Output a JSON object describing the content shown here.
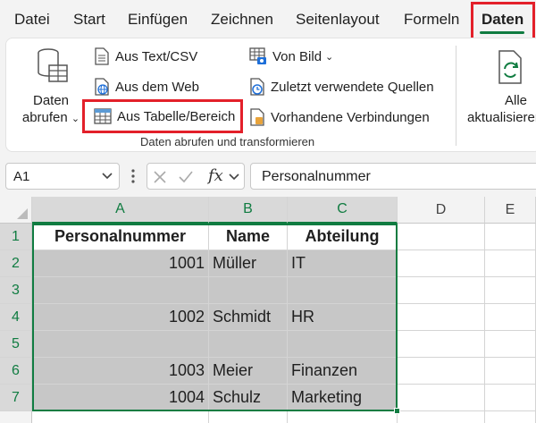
{
  "tabs": [
    "Datei",
    "Start",
    "Einfügen",
    "Zeichnen",
    "Seitenlayout",
    "Formeln",
    "Daten"
  ],
  "active_tab": "Daten",
  "ribbon": {
    "get_data": {
      "line1": "Daten",
      "line2": "abrufen"
    },
    "from_text_csv": "Aus Text/CSV",
    "from_web": "Aus dem Web",
    "from_table_range": "Aus Tabelle/Bereich",
    "from_picture": "Von Bild",
    "recent_sources": "Zuletzt verwendete Quellen",
    "existing_connections": "Vorhandene Verbindungen",
    "group_label": "Daten abrufen und transformieren",
    "refresh_all": {
      "line1": "Alle",
      "line2": "aktualisieren"
    }
  },
  "formula_bar": {
    "name_box": "A1",
    "fx_symbol": "fx",
    "formula": "Personalnummer"
  },
  "grid": {
    "columns": [
      "A",
      "B",
      "C",
      "D",
      "E"
    ],
    "rows": [
      "1",
      "2",
      "3",
      "4",
      "5",
      "6",
      "7"
    ],
    "cells": [
      [
        "Personalnummer",
        "Name",
        "Abteilung"
      ],
      [
        "1001",
        "Müller",
        "IT"
      ],
      [
        "",
        "",
        ""
      ],
      [
        "1002",
        "Schmidt",
        "HR"
      ],
      [
        "",
        "",
        ""
      ],
      [
        "1003",
        "Meier",
        "Finanzen"
      ],
      [
        "1004",
        "Schulz",
        "Marketing"
      ]
    ]
  },
  "colors": {
    "accent": "#107c41",
    "highlight": "#e3202a",
    "selection": "#c7c7c7"
  }
}
